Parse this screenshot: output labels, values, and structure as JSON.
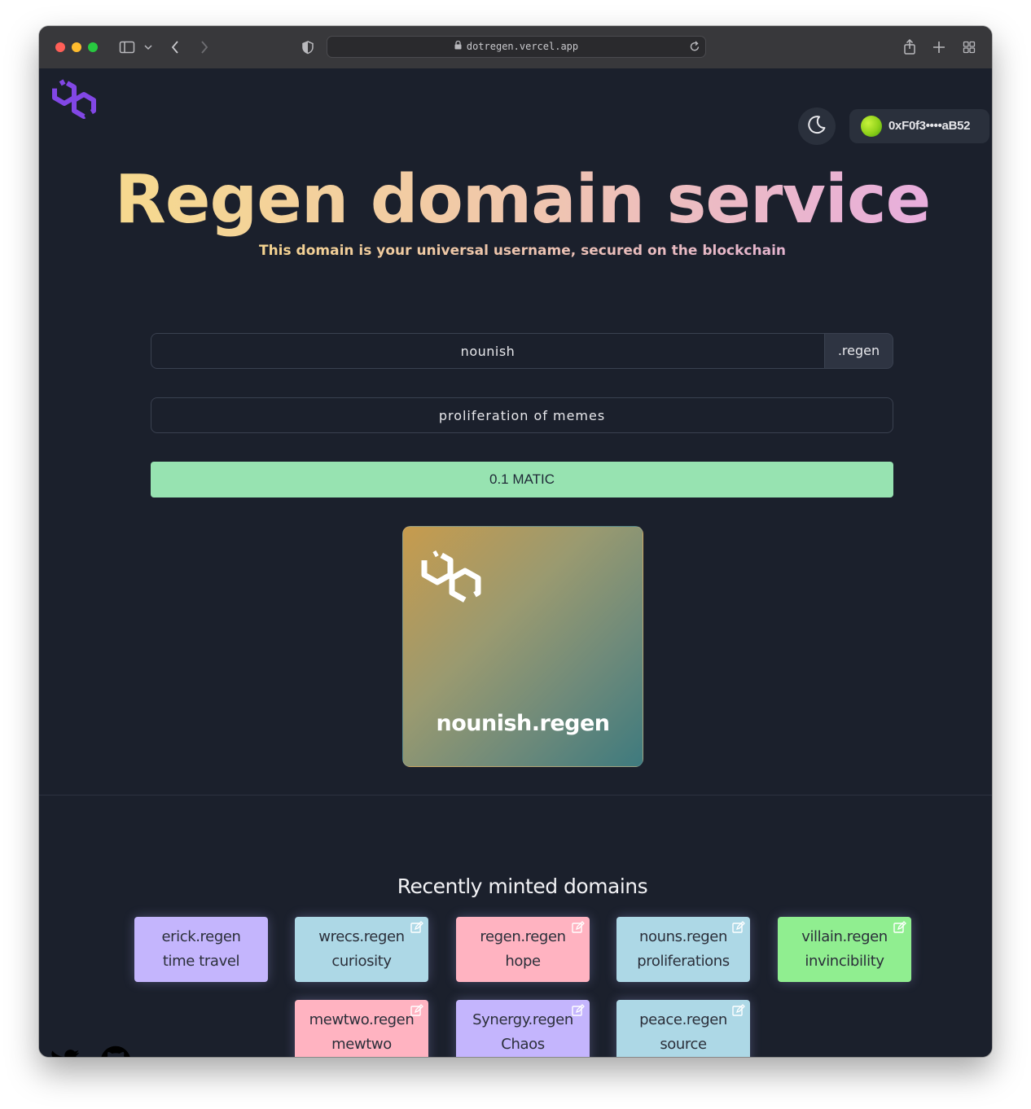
{
  "browser": {
    "url": "dotregen.vercel.app"
  },
  "header": {
    "wallet_address": "0xF0f3••••aB52"
  },
  "hero": {
    "title": "Regen domain service",
    "subtitle": "This domain is your universal username, secured on the blockchain"
  },
  "form": {
    "domain_value": "nounish",
    "tld": ".regen",
    "record_value": "proliferation of memes",
    "mint_label": "0.1 MATIC"
  },
  "preview": {
    "domain_name": "nounish.regen"
  },
  "recent": {
    "title": "Recently minted domains",
    "items": [
      {
        "name": "erick.regen",
        "record": "time travel",
        "color": "#c4b5fd",
        "editable": false
      },
      {
        "name": "wrecs.regen",
        "record": "curiosity",
        "color": "#add8e6",
        "editable": true
      },
      {
        "name": "regen.regen",
        "record": "hope",
        "color": "#ffb3c1",
        "editable": true
      },
      {
        "name": "nouns.regen",
        "record": "proliferations",
        "color": "#add8e6",
        "editable": true
      },
      {
        "name": "villain.regen",
        "record": "invincibility",
        "color": "#90ee90",
        "editable": true
      },
      {
        "name": "mewtwo.regen",
        "record": "mewtwo",
        "color": "#ffb3c1",
        "editable": true
      },
      {
        "name": "Synergy.regen",
        "record": "Chaos",
        "color": "#c4b5fd",
        "editable": true
      },
      {
        "name": "peace.regen",
        "record": "source",
        "color": "#add8e6",
        "editable": true
      }
    ]
  },
  "icons": {
    "logo": "polygon-logo-icon",
    "theme": "moon-icon",
    "edit": "edit-icon",
    "twitter": "twitter-icon",
    "github": "github-icon"
  },
  "colors": {
    "background": "#1b202c",
    "mint_button": "#97e3b1",
    "logo_purple": "#8247e5"
  }
}
